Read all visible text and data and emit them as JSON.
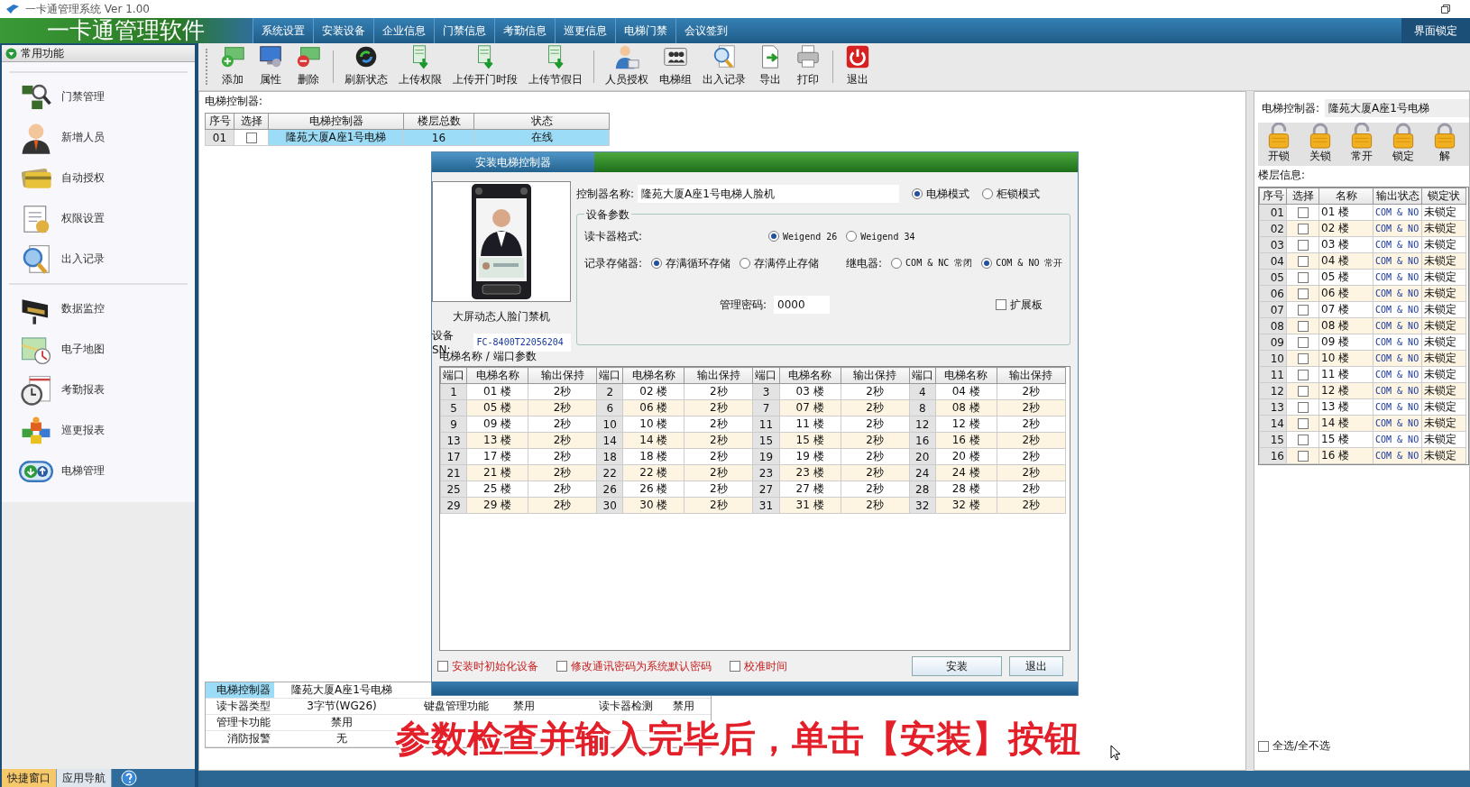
{
  "window": {
    "title": "一卡通管理系统  Ver 1.00"
  },
  "app_title": "一卡通管理软件",
  "menu": [
    "系统设置",
    "安装设备",
    "企业信息",
    "门禁信息",
    "考勤信息",
    "巡更信息",
    "电梯门禁",
    "会议签到"
  ],
  "lock_button": "界面锁定",
  "sidebar": {
    "title": "常用功能",
    "groups": [
      [
        {
          "label": "门禁管理",
          "kind": "chips"
        },
        {
          "label": "新增人员",
          "kind": "person"
        },
        {
          "label": "自动授权",
          "kind": "card"
        },
        {
          "label": "权限设置",
          "kind": "document"
        },
        {
          "label": "出入记录",
          "kind": "magnifier"
        }
      ],
      [
        {
          "label": "数据监控",
          "kind": "camera"
        },
        {
          "label": "电子地图",
          "kind": "map"
        },
        {
          "label": "考勤报表",
          "kind": "stopwatch"
        },
        {
          "label": "巡更报表",
          "kind": "blocks"
        },
        {
          "label": "电梯管理",
          "kind": "elevator"
        }
      ]
    ]
  },
  "bottom_tabs": [
    {
      "label": "快捷窗口",
      "selected": true
    },
    {
      "label": "应用导航",
      "selected": false
    }
  ],
  "toolbar": [
    [
      {
        "label": "添加",
        "kind": "add"
      },
      {
        "label": "属性",
        "kind": "props"
      },
      {
        "label": "删除",
        "kind": "delete"
      }
    ],
    [
      {
        "label": "刷新状态",
        "kind": "refresh"
      },
      {
        "label": "上传权限",
        "kind": "upload"
      },
      {
        "label": "上传开门时段",
        "kind": "upload"
      },
      {
        "label": "上传节假日",
        "kind": "upload"
      }
    ],
    [
      {
        "label": "人员授权",
        "kind": "user"
      },
      {
        "label": "电梯组",
        "kind": "group"
      },
      {
        "label": "出入记录",
        "kind": "search"
      },
      {
        "label": "导出",
        "kind": "export"
      },
      {
        "label": "打印",
        "kind": "print"
      }
    ],
    [
      {
        "label": "退出",
        "kind": "exit"
      }
    ]
  ],
  "controller_label": "电梯控制器:",
  "controller_table": {
    "columns": [
      "序号",
      "选择",
      "电梯控制器",
      "楼层总数",
      "状态"
    ],
    "rows": [
      {
        "selected": true,
        "cells": [
          {
            "text": "01"
          },
          {
            "checked": false
          },
          {
            "text": "隆苑大厦A座1号电梯"
          },
          {
            "text": "16"
          },
          {
            "text": "在线"
          }
        ]
      }
    ]
  },
  "info_panel": [
    [
      "电梯控制器",
      "隆苑大厦A座1号电梯"
    ],
    [
      "读卡器类型",
      "3字节(WG26)",
      "键盘管理功能",
      "禁用",
      "读卡器检测",
      "禁用"
    ],
    [
      "管理卡功能",
      "禁用"
    ],
    [
      "消防报警",
      "无"
    ]
  ],
  "right_panel": {
    "label": "电梯控制器:",
    "value": "隆苑大厦A座1号电梯",
    "lock_buttons": [
      {
        "label": "开锁",
        "kind": "open"
      },
      {
        "label": "关锁",
        "kind": "closed"
      },
      {
        "label": "常开",
        "kind": "open"
      },
      {
        "label": "锁定",
        "kind": "closed"
      },
      {
        "label": "解",
        "kind": "closed"
      }
    ],
    "floors_label": "楼层信息:",
    "columns": [
      "序号",
      "选择",
      "名称",
      "输出状态",
      "锁定状"
    ],
    "floors": [
      {
        "no": "01",
        "checked": false,
        "name": "01 楼",
        "output": "COM & NO",
        "lock": "未锁定"
      },
      {
        "no": "02",
        "checked": false,
        "name": "02 楼",
        "output": "COM & NO",
        "lock": "未锁定"
      },
      {
        "no": "03",
        "checked": false,
        "name": "03 楼",
        "output": "COM & NO",
        "lock": "未锁定"
      },
      {
        "no": "04",
        "checked": false,
        "name": "04 楼",
        "output": "COM & NO",
        "lock": "未锁定"
      },
      {
        "no": "05",
        "checked": false,
        "name": "05 楼",
        "output": "COM & NO",
        "lock": "未锁定"
      },
      {
        "no": "06",
        "checked": false,
        "name": "06 楼",
        "output": "COM & NO",
        "lock": "未锁定"
      },
      {
        "no": "07",
        "checked": false,
        "name": "07 楼",
        "output": "COM & NO",
        "lock": "未锁定"
      },
      {
        "no": "08",
        "checked": false,
        "name": "08 楼",
        "output": "COM & NO",
        "lock": "未锁定"
      },
      {
        "no": "09",
        "checked": false,
        "name": "09 楼",
        "output": "COM & NO",
        "lock": "未锁定"
      },
      {
        "no": "10",
        "checked": false,
        "name": "10 楼",
        "output": "COM & NO",
        "lock": "未锁定"
      },
      {
        "no": "11",
        "checked": false,
        "name": "11 楼",
        "output": "COM & NO",
        "lock": "未锁定"
      },
      {
        "no": "12",
        "checked": false,
        "name": "12 楼",
        "output": "COM & NO",
        "lock": "未锁定"
      },
      {
        "no": "13",
        "checked": false,
        "name": "13 楼",
        "output": "COM & NO",
        "lock": "未锁定"
      },
      {
        "no": "14",
        "checked": false,
        "name": "14 楼",
        "output": "COM & NO",
        "lock": "未锁定"
      },
      {
        "no": "15",
        "checked": false,
        "name": "15 楼",
        "output": "COM & NO",
        "lock": "未锁定"
      },
      {
        "no": "16",
        "checked": false,
        "name": "16 楼",
        "output": "COM & NO",
        "lock": "未锁定"
      }
    ],
    "select_all": {
      "label": "全选/全不选",
      "checked": false
    }
  },
  "dialog": {
    "title": "安装电梯控制器",
    "device_caption": "大屏动态人脸门禁机",
    "sn_label": "设备SN:",
    "sn_value": "FC-8400T22056204",
    "name_label": "控制器名称:",
    "name_value": "隆苑大厦A座1号电梯人脸机",
    "modes": [
      {
        "label": "电梯模式",
        "selected": true
      },
      {
        "label": "柜锁模式",
        "selected": false
      }
    ],
    "group_title": "设备参数",
    "reader_label": "读卡器格式:",
    "reader_options": [
      {
        "label": "Weigend 26",
        "selected": true
      },
      {
        "label": "Weigend 34",
        "selected": false
      }
    ],
    "storage_label": "记录存储器:",
    "storage_options": [
      {
        "label": "存满循环存储",
        "selected": true
      },
      {
        "label": "存满停止存储",
        "selected": false
      }
    ],
    "relay_label": "继电器:",
    "relay_options": [
      {
        "label": "COM & NC 常闭",
        "selected": false
      },
      {
        "label": "COM & NO 常开",
        "selected": true
      }
    ],
    "password_label": "管理密码:",
    "password_value": "0000",
    "expansion": {
      "label": "扩展板",
      "checked": false
    },
    "ports_title": "电梯名称 / 端口参数",
    "port_columns": [
      "端口",
      "电梯名称",
      "输出保持",
      "端口",
      "电梯名称",
      "输出保持",
      "端口",
      "电梯名称",
      "输出保持",
      "端口",
      "电梯名称",
      "输出保持"
    ],
    "ports": [
      {
        "port": "1",
        "name": "01 楼",
        "hold": "2秒"
      },
      {
        "port": "2",
        "name": "02 楼",
        "hold": "2秒"
      },
      {
        "port": "3",
        "name": "03 楼",
        "hold": "2秒"
      },
      {
        "port": "4",
        "name": "04 楼",
        "hold": "2秒"
      },
      {
        "port": "5",
        "name": "05 楼",
        "hold": "2秒"
      },
      {
        "port": "6",
        "name": "06 楼",
        "hold": "2秒"
      },
      {
        "port": "7",
        "name": "07 楼",
        "hold": "2秒"
      },
      {
        "port": "8",
        "name": "08 楼",
        "hold": "2秒"
      },
      {
        "port": "9",
        "name": "09 楼",
        "hold": "2秒"
      },
      {
        "port": "10",
        "name": "10 楼",
        "hold": "2秒"
      },
      {
        "port": "11",
        "name": "11 楼",
        "hold": "2秒"
      },
      {
        "port": "12",
        "name": "12 楼",
        "hold": "2秒"
      },
      {
        "port": "13",
        "name": "13 楼",
        "hold": "2秒"
      },
      {
        "port": "14",
        "name": "14 楼",
        "hold": "2秒"
      },
      {
        "port": "15",
        "name": "15 楼",
        "hold": "2秒"
      },
      {
        "port": "16",
        "name": "16 楼",
        "hold": "2秒"
      },
      {
        "port": "17",
        "name": "17 楼",
        "hold": "2秒"
      },
      {
        "port": "18",
        "name": "18 楼",
        "hold": "2秒"
      },
      {
        "port": "19",
        "name": "19 楼",
        "hold": "2秒"
      },
      {
        "port": "20",
        "name": "20 楼",
        "hold": "2秒"
      },
      {
        "port": "21",
        "name": "21 楼",
        "hold": "2秒"
      },
      {
        "port": "22",
        "name": "22 楼",
        "hold": "2秒"
      },
      {
        "port": "23",
        "name": "23 楼",
        "hold": "2秒"
      },
      {
        "port": "24",
        "name": "24 楼",
        "hold": "2秒"
      },
      {
        "port": "25",
        "name": "25 楼",
        "hold": "2秒"
      },
      {
        "port": "26",
        "name": "26 楼",
        "hold": "2秒"
      },
      {
        "port": "27",
        "name": "27 楼",
        "hold": "2秒"
      },
      {
        "port": "28",
        "name": "28 楼",
        "hold": "2秒"
      },
      {
        "port": "29",
        "name": "29 楼",
        "hold": "2秒"
      },
      {
        "port": "30",
        "name": "30 楼",
        "hold": "2秒"
      },
      {
        "port": "31",
        "name": "31 楼",
        "hold": "2秒"
      },
      {
        "port": "32",
        "name": "32 楼",
        "hold": "2秒"
      }
    ],
    "options": [
      {
        "label": "安装时初始化设备",
        "checked": false
      },
      {
        "label": "修改通讯密码为系统默认密码",
        "checked": false
      },
      {
        "label": "校准时间",
        "checked": false
      }
    ],
    "buttons": [
      "安装",
      "退出"
    ]
  },
  "subtitle": "参数检查并输入完毕后，单击【安装】按钮"
}
